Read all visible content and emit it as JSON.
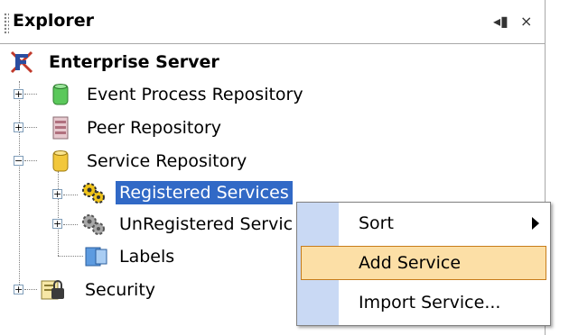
{
  "explorer": {
    "title": "Explorer",
    "pin_glyph": "◂▮",
    "close_glyph": "×"
  },
  "tree": {
    "root": "Enterprise Server",
    "event_process_repository": "Event Process Repository",
    "peer_repository": "Peer Repository",
    "service_repository": "Service Repository",
    "registered_services": "Registered Services",
    "unregistered_services": "UnRegistered Servic",
    "labels": "Labels",
    "security": "Security"
  },
  "context_menu": {
    "items": [
      {
        "label": "Sort"
      },
      {
        "label": "Add Service"
      },
      {
        "label": "Import Service..."
      }
    ]
  },
  "colors": {
    "selection": "#3169c6",
    "menu_highlight": "#fcdfa6",
    "menu_gutter": "#c9d9f4"
  }
}
